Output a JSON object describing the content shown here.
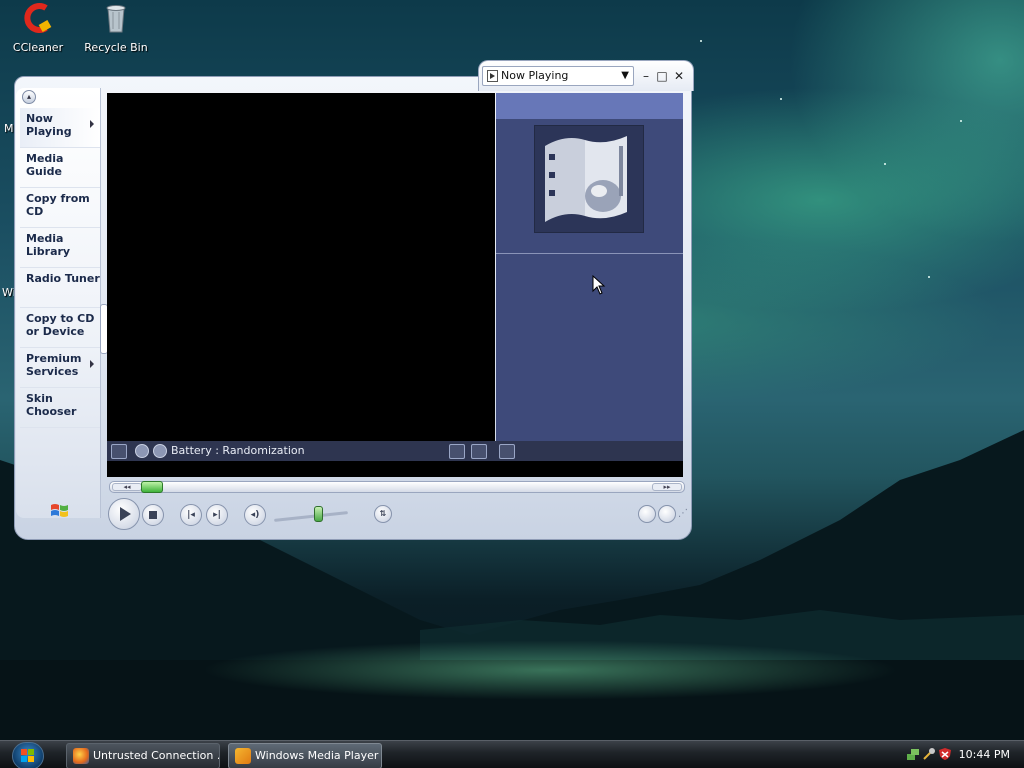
{
  "desktop": {
    "icons": [
      {
        "label": "CCleaner",
        "icon": "ccleaner-icon"
      },
      {
        "label": "Recycle Bin",
        "icon": "recycle-bin-icon"
      }
    ],
    "edge_labels": [
      "Mi",
      "Wi"
    ]
  },
  "wmp": {
    "title_dropdown": {
      "label": "Now Playing",
      "icon": "play-document-icon"
    },
    "window_buttons": {
      "minimize": "–",
      "maximize": "□",
      "close": "✕"
    },
    "taskpane": {
      "items": [
        {
          "label": "Now Playing",
          "selected": true,
          "has_arrow": true
        },
        {
          "label": "Media Guide",
          "selected": false,
          "has_arrow": false
        },
        {
          "label": "Copy from CD",
          "selected": false,
          "has_arrow": false
        },
        {
          "label": "Media Library",
          "selected": false,
          "has_arrow": false
        },
        {
          "label": "Radio Tuner",
          "selected": false,
          "has_arrow": false
        },
        {
          "label": "Copy to CD or Device",
          "selected": false,
          "has_arrow": false
        },
        {
          "label": "Premium Services",
          "selected": false,
          "has_arrow": true
        },
        {
          "label": "Skin Chooser",
          "selected": false,
          "has_arrow": false
        }
      ]
    },
    "info_bar": {
      "text": "Battery : Randomization"
    },
    "seek": {
      "rewind": "◂◂",
      "forward": "▸▸",
      "position": 0.04
    },
    "controls": {
      "prev": "|◂",
      "next": "▸|",
      "mute": "◂)",
      "shuffle": "⇅",
      "volume": 0.5
    },
    "colors": {
      "vis_header": "#6777b8",
      "vis_bg": "#3e4a7a",
      "seek_thumb": "#3fb33a"
    }
  },
  "taskbar": {
    "buttons": [
      {
        "label": "Untrusted Connection ...",
        "icon": "firefox-icon",
        "active": false
      },
      {
        "label": "Windows Media Player",
        "icon": "media-player-icon",
        "active": true
      }
    ],
    "clock": "10:44 PM"
  }
}
